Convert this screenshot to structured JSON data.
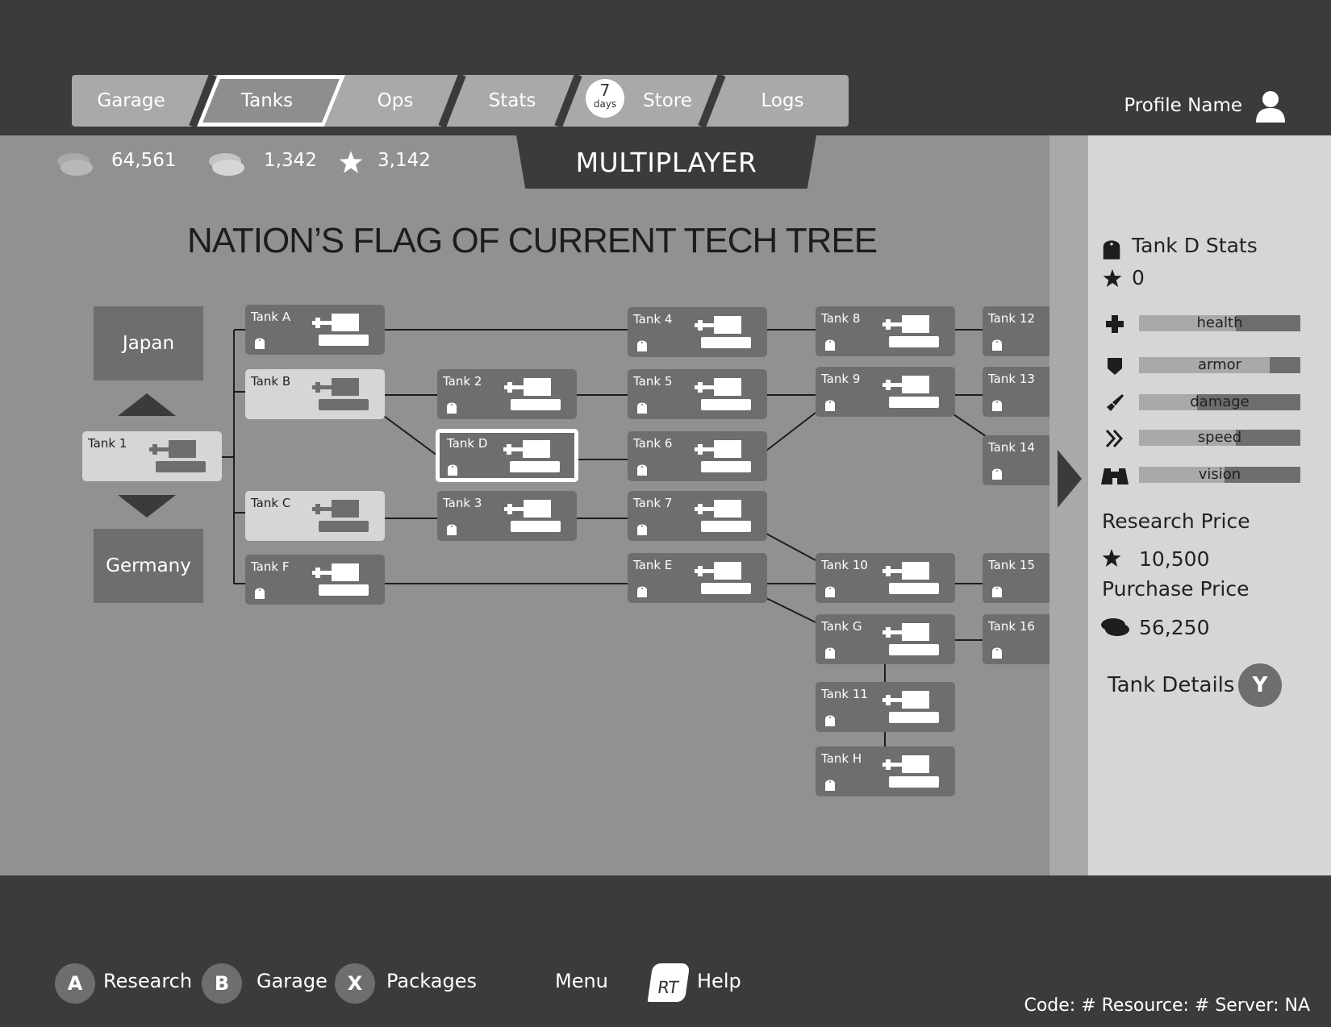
{
  "tabs": [
    {
      "label": "Garage"
    },
    {
      "label": "Tanks"
    },
    {
      "label": "Ops"
    },
    {
      "label": "Stats"
    },
    {
      "label": "Store"
    },
    {
      "label": "Logs"
    }
  ],
  "store_badge": {
    "number": "7",
    "unit": "days"
  },
  "profile": {
    "name": "Profile Name"
  },
  "currencies": {
    "silver": "64,561",
    "gold": "1,342",
    "xp": "3,142"
  },
  "mode": "MULTIPLAYER",
  "tree_title": "NATION’S FLAG OF CURRENT TECH TREE",
  "nations": {
    "prev": "Japan",
    "next": "Germany"
  },
  "tanks": {
    "t1": "Tank 1",
    "ta": "Tank A",
    "tb": "Tank B",
    "tc": "Tank C",
    "tf": "Tank F",
    "t2": "Tank 2",
    "td": "Tank D",
    "t3": "Tank 3",
    "t4": "Tank 4",
    "t5": "Tank 5",
    "t6": "Tank 6",
    "t7": "Tank 7",
    "te": "Tank E",
    "t8": "Tank 8",
    "t9": "Tank 9",
    "t10": "Tank 10",
    "tg": "Tank G",
    "t11": "Tank 11",
    "th": "Tank H",
    "t12": "Tank 12",
    "t13": "Tank 13",
    "t14": "Tank 14",
    "t15": "Tank 15",
    "t16": "Tank 16"
  },
  "side": {
    "title": "Tank D Stats",
    "stars": "0",
    "stats": [
      {
        "label": "health",
        "level": 0.6
      },
      {
        "label": "armor",
        "level": 0.81
      },
      {
        "label": "damage",
        "level": 0.36
      },
      {
        "label": "speed",
        "level": 0.6
      },
      {
        "label": "vision",
        "level": 0.53
      }
    ],
    "research_label": "Research Price",
    "research_value": "10,500",
    "purchase_label": "Purchase Price",
    "purchase_value": "56,250",
    "details_label": "Tank Details",
    "details_button": "Y"
  },
  "bottom": {
    "a_key": "A",
    "a_label": "Research",
    "b_key": "B",
    "b_label": "Garage",
    "x_key": "X",
    "x_label": "Packages",
    "menu_label": "Menu",
    "rt_key": "RT",
    "rt_label": "Help"
  },
  "footer": "Code: # Resource: # Server: NA"
}
